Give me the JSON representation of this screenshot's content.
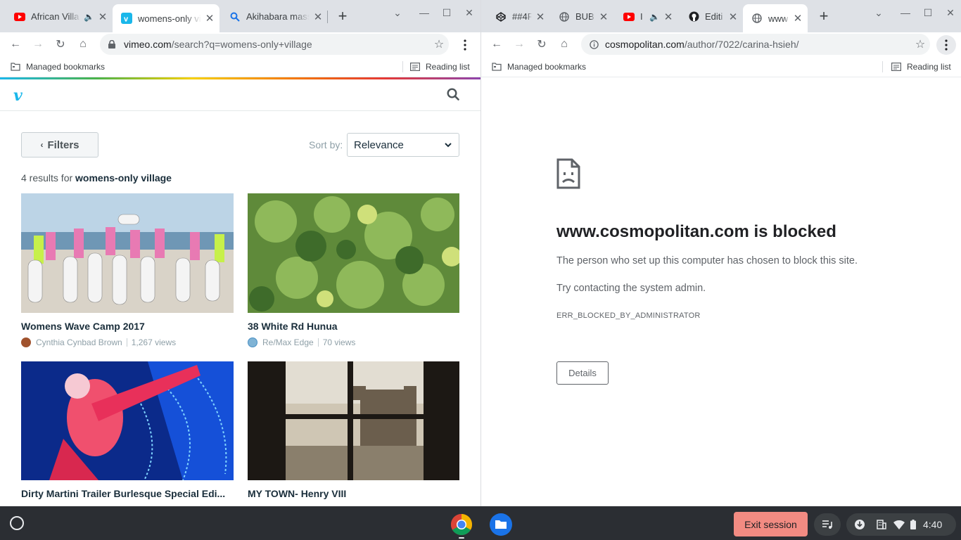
{
  "left_window": {
    "tabs": [
      {
        "title": "African Villa",
        "active": false,
        "audio": true
      },
      {
        "title": "womens-only vil",
        "active": true,
        "audio": false
      },
      {
        "title": "Akihabara mass",
        "active": false,
        "audio": false
      }
    ],
    "new_tab_label": "+",
    "url_domain": "vimeo.com",
    "url_path": "/search?q=womens-only+village",
    "bookmarks": {
      "managed": "Managed bookmarks",
      "reading_list": "Reading list"
    },
    "vimeo": {
      "logo": "v",
      "filters_label": "Filters",
      "sort_label": "Sort by:",
      "sort_value": "Relevance",
      "results_prefix": "4 results for",
      "results_query": "womens-only village",
      "videos": [
        {
          "title": "Womens Wave Camp 2017",
          "author": "Cynthia Cynbad Brown",
          "views": "1,267 views"
        },
        {
          "title": "38 White Rd Hunua",
          "author": "Re/Max Edge",
          "views": "70 views"
        },
        {
          "title": "Dirty Martini Trailer Burlesque Special Edi...",
          "author": "",
          "views": ""
        },
        {
          "title": "MY TOWN- Henry VIII",
          "author": "",
          "views": ""
        }
      ]
    }
  },
  "right_window": {
    "tabs": [
      {
        "title": "##4F",
        "active": false
      },
      {
        "title": "BUBB",
        "active": false
      },
      {
        "title": "I",
        "active": false,
        "audio": true
      },
      {
        "title": "Editi",
        "active": false
      },
      {
        "title": "www",
        "active": true
      }
    ],
    "new_tab_label": "+",
    "url_domain": "cosmopolitan.com",
    "url_path": "/author/7022/carina-hsieh/",
    "bookmarks": {
      "managed": "Managed bookmarks",
      "reading_list": "Reading list"
    },
    "blocked": {
      "title": "www.cosmopolitan.com is blocked",
      "message": "The person who set up this computer has chosen to block this site.",
      "hint": "Try contacting the system admin.",
      "code": "ERR_BLOCKED_BY_ADMINISTRATOR",
      "details_button": "Details"
    }
  },
  "shelf": {
    "apps": [
      "chrome-icon",
      "files-icon"
    ],
    "exit_session": "Exit session",
    "time": "4:40"
  },
  "colors": {
    "vimeo_blue": "#1ab7ea",
    "exit_button": "#f28b82",
    "shelf": "#2b2e33"
  }
}
